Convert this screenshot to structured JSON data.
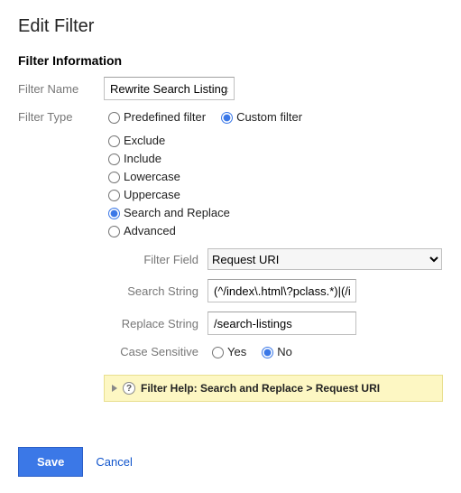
{
  "page": {
    "title": "Edit Filter"
  },
  "section": {
    "title": "Filter Information"
  },
  "labels": {
    "filter_name": "Filter Name",
    "filter_type": "Filter Type",
    "filter_field": "Filter Field",
    "search_string": "Search String",
    "replace_string": "Replace String",
    "case_sensitive": "Case Sensitive"
  },
  "filter_name": {
    "value": "Rewrite Search Listings"
  },
  "filter_type": {
    "predefined": "Predefined filter",
    "custom": "Custom filter",
    "selected": "custom"
  },
  "custom_options": {
    "exclude": "Exclude",
    "include": "Include",
    "lowercase": "Lowercase",
    "uppercase": "Uppercase",
    "search_replace": "Search and Replace",
    "advanced": "Advanced",
    "selected": "search_replace"
  },
  "filter_field": {
    "value": "Request URI"
  },
  "search_string": {
    "value": "(^/index\\.html\\?pclass.*)|(/inc"
  },
  "replace_string": {
    "value": "/search-listings"
  },
  "case_sensitive": {
    "yes": "Yes",
    "no": "No",
    "selected": "no"
  },
  "help": {
    "text": "Filter Help: Search and Replace  >  Request URI"
  },
  "actions": {
    "save": "Save",
    "cancel": "Cancel"
  }
}
